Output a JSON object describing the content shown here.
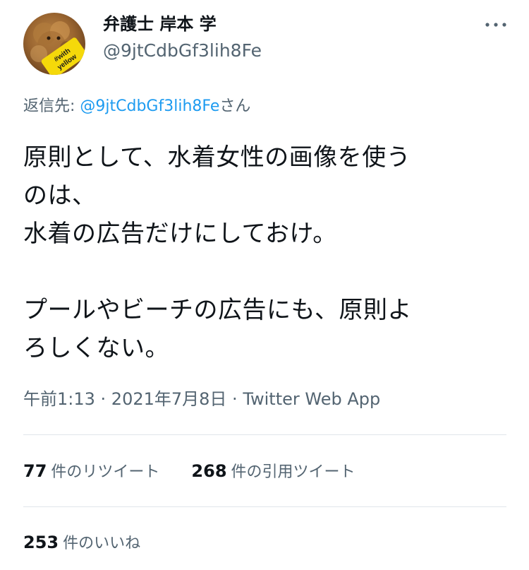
{
  "author": {
    "display_name": "弁護士 岸本 学",
    "handle": "@9jtCdbGf3lih8Fe",
    "avatar_badge_text": "#with yellow"
  },
  "reply": {
    "prefix": "返信先: ",
    "mention": "@9jtCdbGf3lih8Fe",
    "suffix": "さん"
  },
  "tweet": {
    "text": "原則として、水着女性の画像を使う\nのは、\n水着の広告だけにしておけ。\n\nプールやビーチの広告にも、原則よ\nろしくない。"
  },
  "meta": {
    "time": "午前1:13",
    "separator1": " · ",
    "date": "2021年7月8日",
    "separator2": " · ",
    "source": "Twitter Web App"
  },
  "stats": {
    "retweets": {
      "count": "77",
      "label": "件のリツイート"
    },
    "quotes": {
      "count": "268",
      "label": "件の引用ツイート"
    },
    "likes": {
      "count": "253",
      "label": "件のいいね"
    }
  },
  "icons": {
    "more": "more-horizontal-icon"
  },
  "colors": {
    "link": "#1d9bf0",
    "secondary_text": "#536471",
    "badge": "#f5d90a"
  }
}
